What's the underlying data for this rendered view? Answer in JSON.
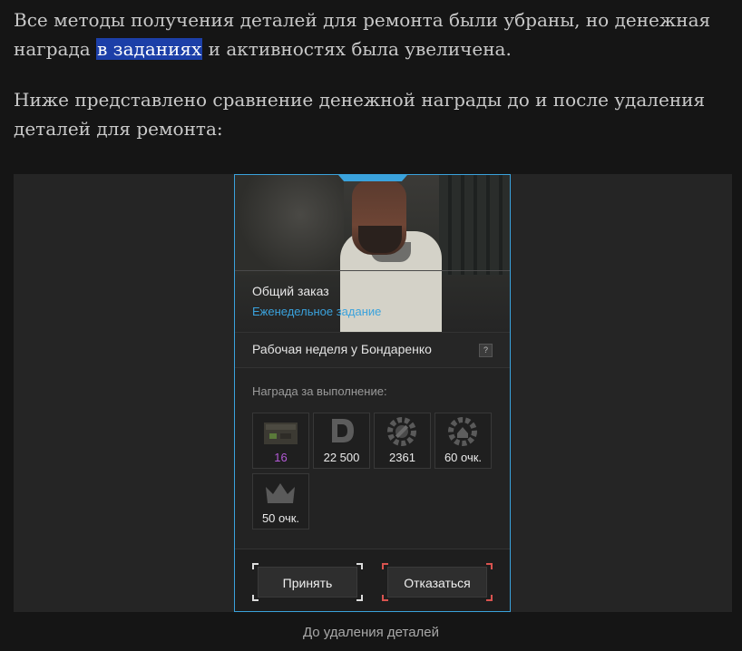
{
  "article": {
    "para1_before": "Все методы получения деталей для ремонта были убраны, но денежная награда ",
    "para1_highlight": "в заданиях",
    "para1_after": " и активностях была увеличена.",
    "para2": "Ниже представлено сравнение денежной награды до и после удаления деталей для ремонта:"
  },
  "card": {
    "order_title": "Общий заказ",
    "order_subtitle": "Еженедельное задание",
    "task_name": "Рабочая неделя у Бондаренко",
    "help_label": "?",
    "reward_title": "Награда за выполнение:",
    "rewards": [
      {
        "icon": "parts-crate-icon",
        "value": "16"
      },
      {
        "icon": "currency-d-icon",
        "value": "22 500"
      },
      {
        "icon": "gear-wrench-icon",
        "value": "2361"
      },
      {
        "icon": "reputation-gear-icon",
        "value": "60 очк."
      },
      {
        "icon": "crown-icon",
        "value": "50 очк."
      }
    ],
    "accept_label": "Принять",
    "decline_label": "Отказаться",
    "colors": {
      "accent": "#3aa2dc",
      "decline": "#d9534f",
      "purple": "#b35ad6"
    }
  },
  "figure": {
    "caption": "До удаления деталей"
  }
}
